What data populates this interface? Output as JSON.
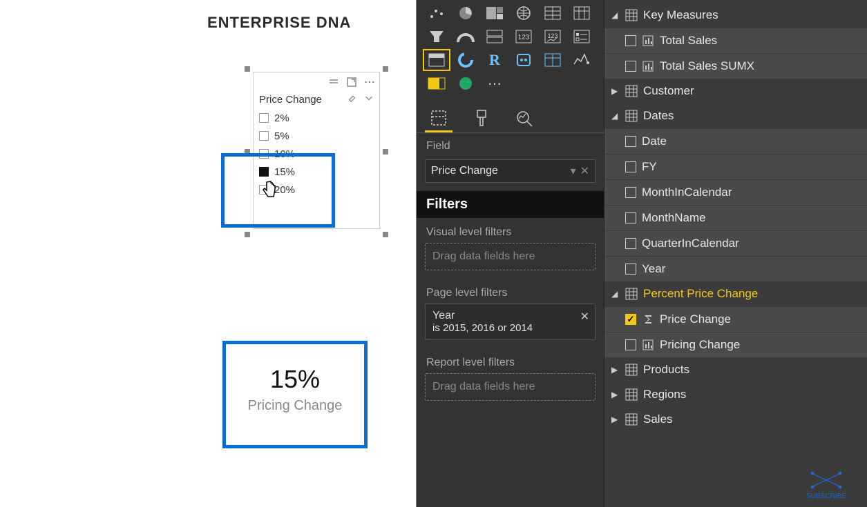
{
  "logo": {
    "text1": "ENTERPRISE",
    "text2": "DNA"
  },
  "slicer": {
    "title": "Price Change",
    "options": [
      {
        "label": "2%",
        "checked": false
      },
      {
        "label": "5%",
        "checked": false
      },
      {
        "label": "10%",
        "checked": false
      },
      {
        "label": "15%",
        "checked": true
      },
      {
        "label": "20%",
        "checked": false
      }
    ]
  },
  "card": {
    "value": "15%",
    "label": "Pricing Change"
  },
  "viz_pane": {
    "field_label": "Field",
    "field_well": "Price Change",
    "filters_header": "Filters",
    "visual_filters_label": "Visual level filters",
    "drop_hint": "Drag data fields here",
    "page_filters_label": "Page level filters",
    "year_filter_title": "Year",
    "year_filter_sub": "is 2015, 2016 or 2014",
    "report_filters_label": "Report level filters"
  },
  "fields": {
    "tables": [
      {
        "name": "Key Measures",
        "expanded": true,
        "fields": [
          {
            "name": "Total Sales",
            "type": "measure",
            "checked": false
          },
          {
            "name": "Total Sales SUMX",
            "type": "measure",
            "checked": false
          }
        ]
      },
      {
        "name": "Customer",
        "expanded": false
      },
      {
        "name": "Dates",
        "expanded": true,
        "fields": [
          {
            "name": "Date",
            "checked": false
          },
          {
            "name": "FY",
            "checked": false
          },
          {
            "name": "MonthInCalendar",
            "checked": false
          },
          {
            "name": "MonthName",
            "checked": false
          },
          {
            "name": "QuarterInCalendar",
            "checked": false
          },
          {
            "name": "Year",
            "checked": false
          }
        ]
      },
      {
        "name": "Percent Price Change",
        "expanded": true,
        "highlight": true,
        "fields": [
          {
            "name": "Price Change",
            "type": "sigma",
            "checked": true
          },
          {
            "name": "Pricing Change",
            "type": "measure",
            "checked": false
          }
        ]
      },
      {
        "name": "Products",
        "expanded": false
      },
      {
        "name": "Regions",
        "expanded": false
      },
      {
        "name": "Sales",
        "expanded": false
      }
    ]
  },
  "subscribe": {
    "label": "SUBSCRIBE"
  }
}
